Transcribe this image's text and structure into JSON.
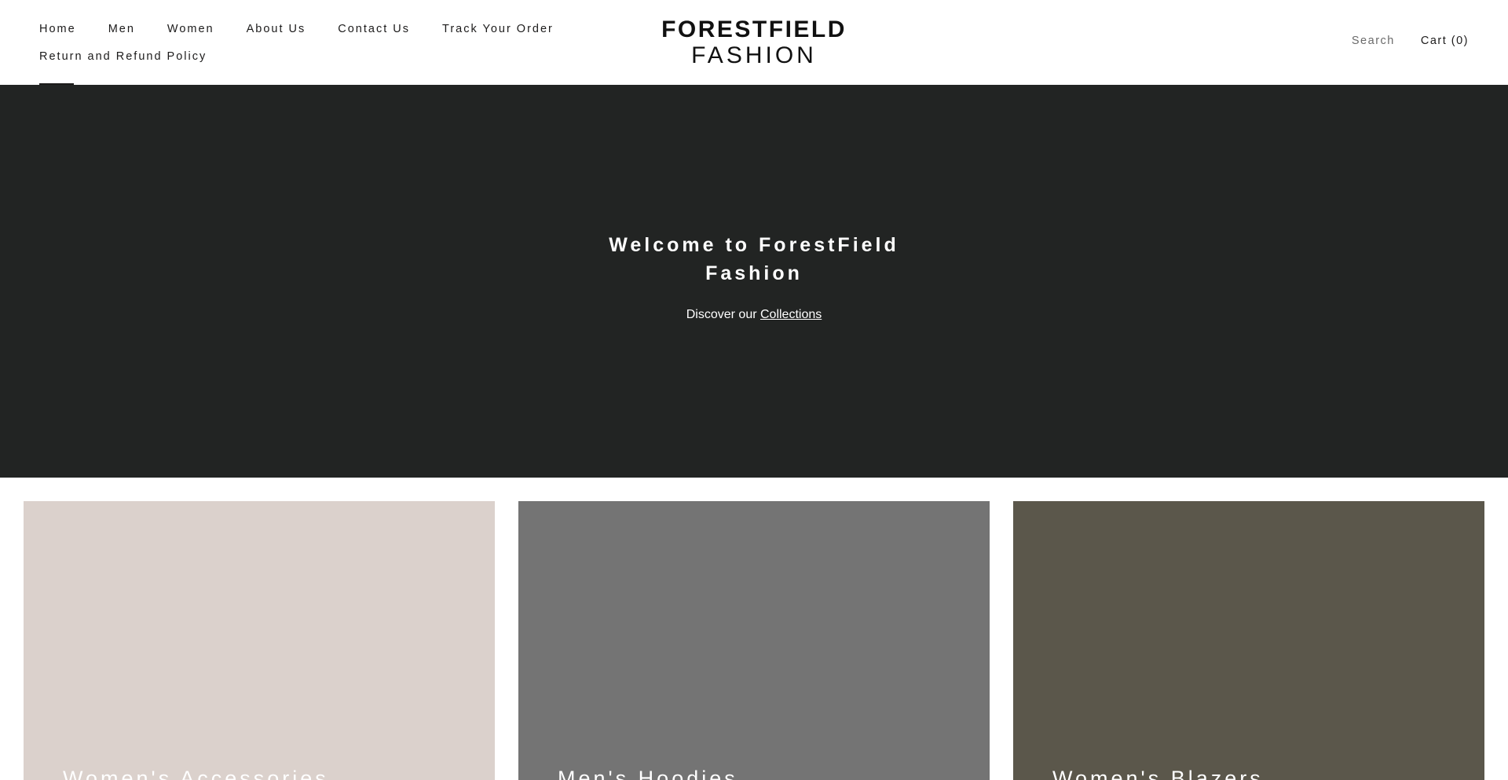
{
  "nav": {
    "items": [
      {
        "label": "Home",
        "name": "nav-home"
      },
      {
        "label": "Men",
        "name": "nav-men"
      },
      {
        "label": "Women",
        "name": "nav-women"
      },
      {
        "label": "About Us",
        "name": "nav-about-us"
      },
      {
        "label": "Contact Us",
        "name": "nav-contact-us"
      },
      {
        "label": "Track Your Order",
        "name": "nav-track-your-order"
      },
      {
        "label": "Return and Refund Policy",
        "name": "nav-return-refund-policy"
      }
    ],
    "active": "Home"
  },
  "logo": {
    "line1": "FORESTFIELD",
    "line2": "FASHION"
  },
  "header": {
    "search_label": "Search",
    "cart_label": "Cart (0)"
  },
  "hero": {
    "title_line1": "Welcome to ForestField",
    "title_line2": "Fashion",
    "subtitle_prefix": "Discover our ",
    "subtitle_link": "Collections",
    "background": "#222423"
  },
  "collections": [
    {
      "label": "Women's Accessories",
      "color": "#dbd1cc"
    },
    {
      "label": "Men's Hoodies",
      "color": "#747474"
    },
    {
      "label": "Women's Blazers",
      "color": "#5b574b"
    }
  ]
}
